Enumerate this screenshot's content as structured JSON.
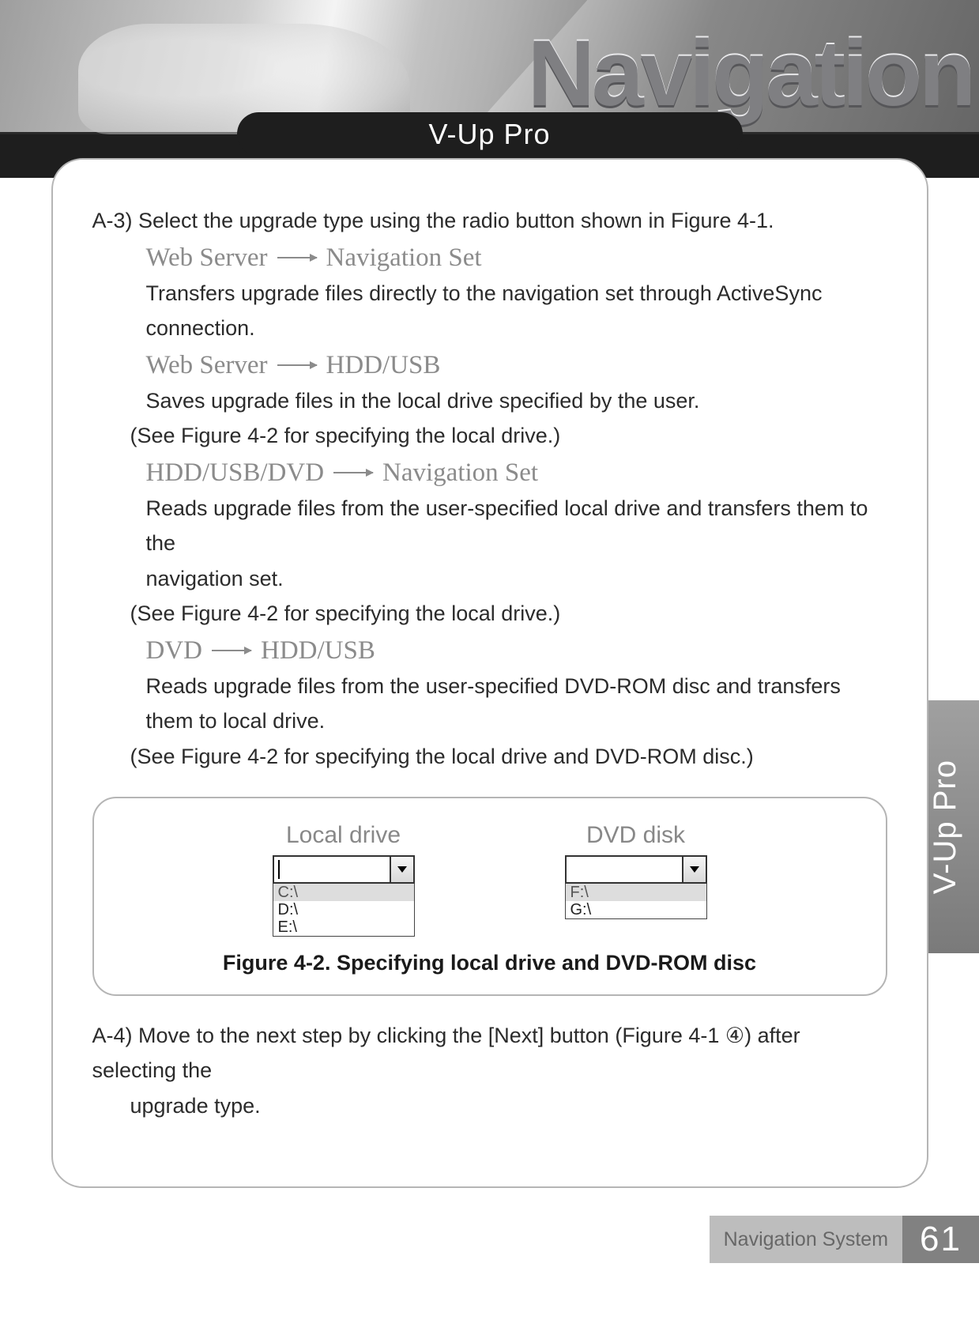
{
  "banner": {
    "nav_title": "Navigation"
  },
  "tab": {
    "label": "V-Up Pro"
  },
  "side_tab": {
    "label": "V-Up Pro"
  },
  "content": {
    "a3_intro": "A-3) Select the upgrade type using the radio button shown in Figure 4-1.",
    "opt1_from": "Web Server",
    "opt1_to": "Navigation Set",
    "opt1_desc": "Transfers upgrade files directly to the navigation set through ActiveSync connection.",
    "opt2_from": "Web Server",
    "opt2_to": "HDD/USB",
    "opt2_desc": "Saves upgrade files in the local drive specified by the user.",
    "opt2_note": "(See Figure 4-2 for specifying the local drive.)",
    "opt3_from": "HDD/USB/DVD",
    "opt3_to": "Navigation Set",
    "opt3_desc1": "Reads upgrade files from the user-specified local drive and transfers them to the",
    "opt3_desc2": "navigation set.",
    "opt3_note": "(See Figure 4-2 for specifying the local drive.)",
    "opt4_from": "DVD",
    "opt4_to": "HDD/USB",
    "opt4_desc": "Reads upgrade files from the user-specified DVD-ROM disc and transfers them to local drive.",
    "opt4_note": "(See Figure 4-2 for specifying the local drive and DVD-ROM disc.)",
    "a4_text": "A-4) Move to the next step by clicking the [Next] button (Figure 4-1 ④) after selecting the",
    "a4_text2": "upgrade type."
  },
  "figure": {
    "local_label": "Local drive",
    "dvd_label": "DVD disk",
    "local_items": [
      "C:\\",
      "D:\\",
      "E:\\"
    ],
    "dvd_items": [
      "F:\\",
      "G:\\"
    ],
    "caption": "Figure 4-2. Specifying local drive and DVD-ROM disc"
  },
  "footer": {
    "label": "Navigation System",
    "page": "61"
  }
}
